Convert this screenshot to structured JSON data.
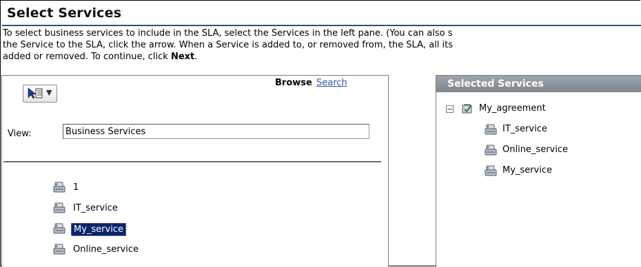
{
  "page": {
    "title": "Select Services",
    "description_line1": "To select business services to include in the SLA, select the Services in the left pane. (You can also s",
    "description_line2": "the Service to the SLA, click the arrow. When a Service is added to, or removed from, the SLA, all its",
    "description_line3_pre": "added or removed. To continue, click ",
    "description_line3_bold": "Next",
    "description_line3_post": "."
  },
  "left_pane": {
    "browse_label": "Browse",
    "search_label": "Search",
    "view_label": "View:",
    "view_value": "Business Services",
    "services": [
      {
        "label": "1",
        "selected": false
      },
      {
        "label": "IT_service",
        "selected": false
      },
      {
        "label": "My_service",
        "selected": true
      },
      {
        "label": "Online_service",
        "selected": false
      }
    ]
  },
  "right_pane": {
    "header": "Selected Services",
    "expander": "−",
    "root": {
      "label": "My_agreement"
    },
    "children": [
      {
        "label": "IT_service"
      },
      {
        "label": "Online_service"
      },
      {
        "label": "My_service"
      }
    ]
  },
  "colors": {
    "title_rule": "#2c4f83",
    "selection": "#0a246a",
    "link": "#3355aa",
    "header_bg": "#8b929a"
  },
  "icons": {
    "tool_button": "view-options-icon",
    "service": "business-service-icon",
    "agreement": "agreement-icon"
  }
}
